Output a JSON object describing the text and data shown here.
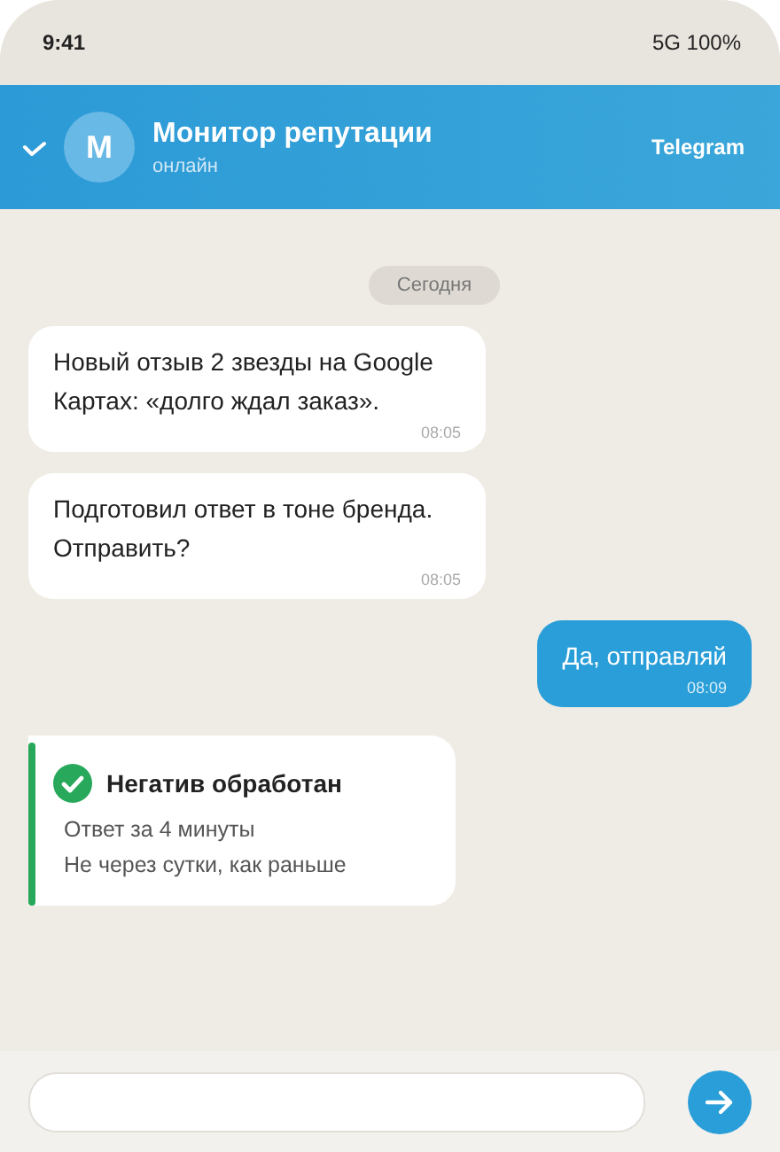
{
  "status_bar": {
    "time": "9:41",
    "network": "5G 100%"
  },
  "header": {
    "avatar_letter": "M",
    "title": "Монитор репутации",
    "subtitle": "онлайн",
    "platform": "Telegram"
  },
  "date_divider": "Сегодня",
  "messages": [
    {
      "kind": "incoming",
      "text": "Новый отзыв 2 звезды на Google Картах: «долго ждал заказ».",
      "time": "08:05"
    },
    {
      "kind": "incoming",
      "text": "Подготовил ответ в тоне бренда. Отправить?",
      "time": "08:05"
    },
    {
      "kind": "outgoing",
      "text": "Да, отправляй",
      "time": "08:09"
    },
    {
      "kind": "card",
      "title": "Негатив обработан",
      "lines": [
        "Ответ за 4 минуты",
        "Не через сутки, как раньше"
      ],
      "color": "#27a85a"
    }
  ]
}
